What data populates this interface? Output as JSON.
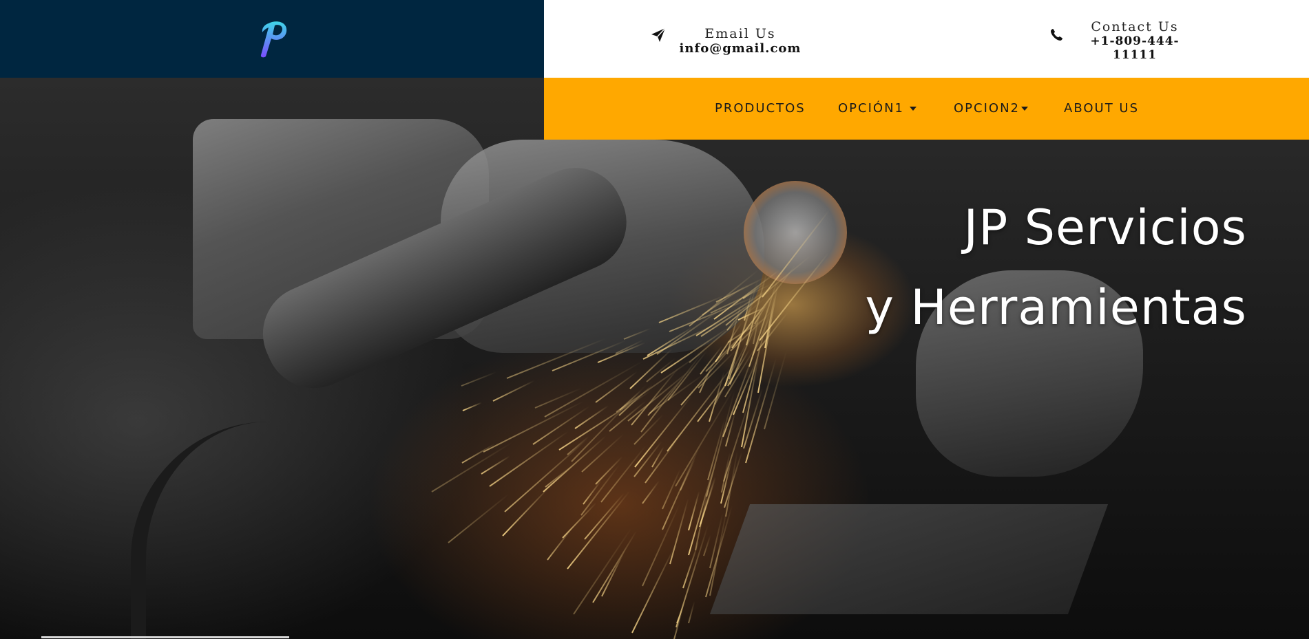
{
  "brand": {
    "logo_icon": "p-letter-logo-icon",
    "colors": {
      "brand_bar": "#002640",
      "nav_bar": "#ffa800",
      "logo_gradient": [
        "#3fd5e8",
        "#7a4dff"
      ]
    }
  },
  "contact": {
    "email": {
      "label": "Email  Us",
      "value": "info@gmail.com",
      "icon": "paper-plane-icon"
    },
    "phone": {
      "label": "Contact  Us",
      "value": "+1-809-444-11111",
      "icon": "phone-icon"
    }
  },
  "nav": {
    "items": [
      {
        "label": "PRODUCTOS",
        "has_dropdown": false
      },
      {
        "label": "OPCIÓN1",
        "has_dropdown": true
      },
      {
        "label": "OPCION2",
        "has_dropdown": true
      },
      {
        "label": "ABOUT US",
        "has_dropdown": false
      }
    ]
  },
  "hero": {
    "title_line1": "JP Servicios",
    "title_line2": "y Herramientas"
  }
}
